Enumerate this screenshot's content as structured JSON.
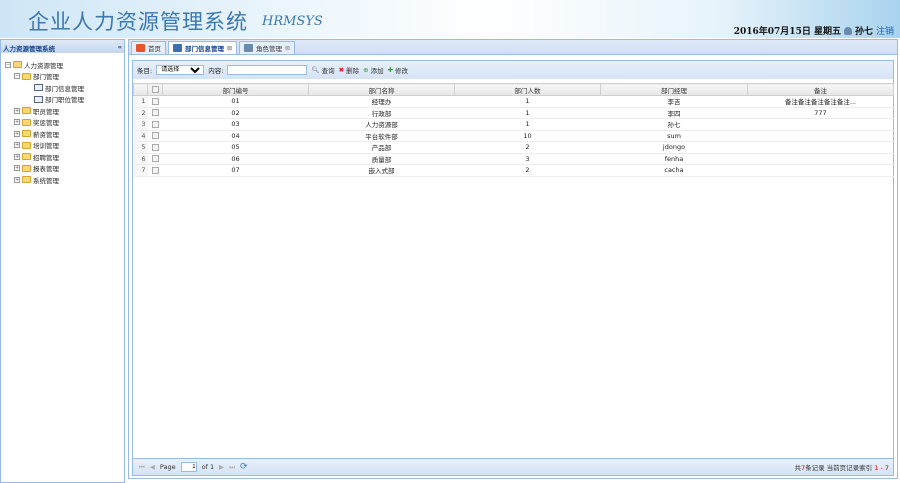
{
  "header": {
    "title": "企业人力资源管理系统",
    "subtitle": "HRMSYS",
    "date": "2016年07月15日 星期五",
    "user": "孙七",
    "logout": "注销"
  },
  "sidebar": {
    "title": "人力资源管理系统",
    "collapse": "«",
    "root": "人力资源管理",
    "dept": "部门管理",
    "dept_children": [
      "部门信息管理",
      "部门职位管理"
    ],
    "groups": [
      "职员管理",
      "奖惩管理",
      "薪资管理",
      "培训管理",
      "招聘管理",
      "报表管理",
      "系统管理"
    ]
  },
  "tabs": [
    {
      "label": "首页"
    },
    {
      "label": "部门信息管理"
    },
    {
      "label": "角色管理"
    }
  ],
  "toolbar": {
    "field_label": "条目:",
    "select_value": "请选择",
    "content_label": "内容:",
    "content_value": "",
    "search": "查询",
    "delete": "删除",
    "add": "添加",
    "edit": "修改"
  },
  "table": {
    "headers": [
      "部门编号",
      "部门名称",
      "部门人数",
      "部门经理",
      "备注"
    ],
    "rows": [
      [
        "01",
        "经理办",
        "1",
        "李吉",
        "备注备注备注备注备注..."
      ],
      [
        "02",
        "行政部",
        "1",
        "李四",
        "777"
      ],
      [
        "03",
        "人力资源部",
        "1",
        "孙七",
        ""
      ],
      [
        "04",
        "平台软件部",
        "10",
        "sum",
        ""
      ],
      [
        "05",
        "产品部",
        "2",
        "jdongo",
        ""
      ],
      [
        "06",
        "质量部",
        "3",
        "fenha",
        ""
      ],
      [
        "07",
        "嵌入式部",
        "2",
        "cacha",
        ""
      ]
    ]
  },
  "pager": {
    "page_label": "Page",
    "page": "1",
    "of": "of 1",
    "summary_a": "共",
    "total": "7",
    "summary_b": "条记录 当前页记录索引",
    "range": "1 - 7"
  }
}
